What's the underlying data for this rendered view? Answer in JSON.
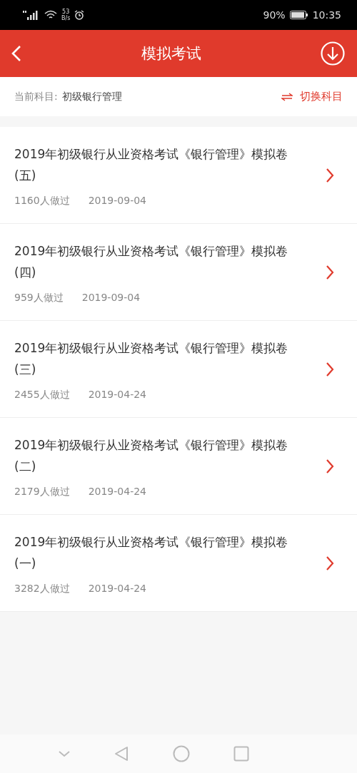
{
  "status_bar": {
    "net_speed": "53",
    "net_unit": "B/s",
    "battery": "90%",
    "time": "10:35"
  },
  "header": {
    "title": "模拟考试"
  },
  "subject": {
    "label": "当前科目:",
    "value": "初级银行管理",
    "switch": "切换科目"
  },
  "exams": [
    {
      "title": "2019年初级银行从业资格考试《银行管理》模拟卷(五)",
      "count": "1160人做过",
      "date": "2019-09-04"
    },
    {
      "title": "2019年初级银行从业资格考试《银行管理》模拟卷(四)",
      "count": "959人做过",
      "date": "2019-09-04"
    },
    {
      "title": "2019年初级银行从业资格考试《银行管理》模拟卷(三)",
      "count": "2455人做过",
      "date": "2019-04-24"
    },
    {
      "title": "2019年初级银行从业资格考试《银行管理》模拟卷(二)",
      "count": "2179人做过",
      "date": "2019-04-24"
    },
    {
      "title": "2019年初级银行从业资格考试《银行管理》模拟卷(一)",
      "count": "3282人做过",
      "date": "2019-04-24"
    }
  ]
}
